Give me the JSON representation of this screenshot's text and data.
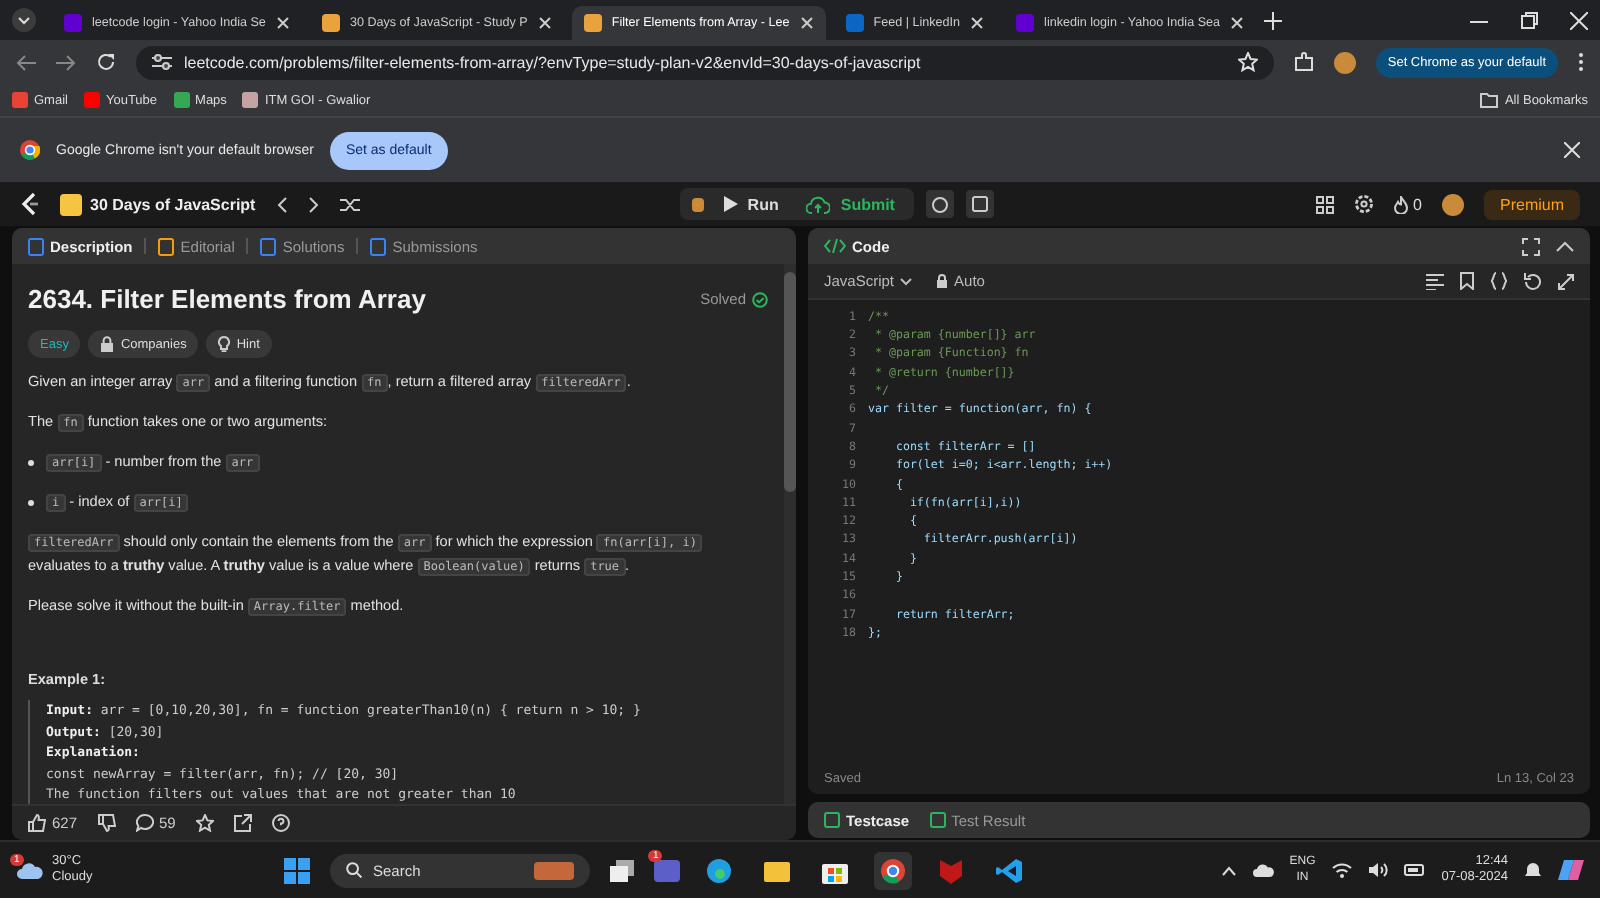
{
  "browser_tabs": [
    {
      "label": "leetcode login - Yahoo India Se",
      "selected": false
    },
    {
      "label": "30 Days of JavaScript - Study P",
      "selected": false
    },
    {
      "label": "Filter Elements from Array - Lee",
      "selected": true
    },
    {
      "label": "Feed | LinkedIn",
      "selected": false
    },
    {
      "label": "linkedin login - Yahoo India Sea",
      "selected": false
    }
  ],
  "address_bar": {
    "url": "leetcode.com/problems/filter-elements-from-array/?envType=study-plan-v2&envId=30-days-of-javascript",
    "default_button": "Set Chrome as your default"
  },
  "bookmarks": {
    "items": [
      "Gmail",
      "YouTube",
      "Maps",
      "ITM GOI - Gwalior"
    ],
    "all": "All Bookmarks"
  },
  "infobar": {
    "message": "Google Chrome isn't your default browser",
    "button": "Set as default"
  },
  "leetcode_nav": {
    "study_plan": "30 Days of JavaScript",
    "run": "Run",
    "submit": "Submit",
    "streak": "0",
    "premium": "Premium"
  },
  "description_panel": {
    "tabs": [
      {
        "label": "Description",
        "selected": true
      },
      {
        "label": "Editorial",
        "selected": false
      },
      {
        "label": "Solutions",
        "selected": false
      },
      {
        "label": "Submissions",
        "selected": false
      }
    ],
    "title": "2634. Filter Elements from Array",
    "status": "Solved",
    "tags": [
      {
        "label": "Easy",
        "kind": "difficulty"
      },
      {
        "label": "Companies",
        "kind": "locked"
      },
      {
        "label": "Hint",
        "kind": "hint"
      }
    ],
    "blocks": [
      {
        "kind": "para",
        "parts": [
          {
            "kind": "text",
            "text": "Given an integer array "
          },
          {
            "kind": "code",
            "text": "arr"
          },
          {
            "kind": "text",
            "text": " and a filtering function "
          },
          {
            "kind": "code",
            "text": "fn"
          },
          {
            "kind": "text",
            "text": ", return a filtered array "
          },
          {
            "kind": "code",
            "text": "filteredArr"
          },
          {
            "kind": "text",
            "text": "."
          }
        ]
      },
      {
        "kind": "para",
        "parts": [
          {
            "kind": "text",
            "text": "The "
          },
          {
            "kind": "code",
            "text": "fn"
          },
          {
            "kind": "text",
            "text": " function takes one or two arguments:"
          }
        ]
      },
      {
        "kind": "bullet",
        "parts": [
          {
            "kind": "code",
            "text": "arr[i]"
          },
          {
            "kind": "text",
            "text": " - number from the "
          },
          {
            "kind": "code",
            "text": "arr"
          }
        ]
      },
      {
        "kind": "bullet",
        "parts": [
          {
            "kind": "code",
            "text": "i"
          },
          {
            "kind": "text",
            "text": " - index of "
          },
          {
            "kind": "code",
            "text": "arr[i]"
          }
        ]
      },
      {
        "kind": "para",
        "parts": [
          {
            "kind": "code",
            "text": "filteredArr"
          },
          {
            "kind": "text",
            "text": " should only contain the elements from the "
          },
          {
            "kind": "code",
            "text": "arr"
          },
          {
            "kind": "text",
            "text": " for which the expression "
          },
          {
            "kind": "code",
            "text": "fn(arr[i], i)"
          },
          {
            "kind": "text",
            "text": " evaluates to a "
          },
          {
            "kind": "bold",
            "text": "truthy"
          },
          {
            "kind": "text",
            "text": " value. A "
          },
          {
            "kind": "bold",
            "text": "truthy"
          },
          {
            "kind": "text",
            "text": " value is a value where "
          },
          {
            "kind": "code",
            "text": "Boolean(value)"
          },
          {
            "kind": "text",
            "text": " returns "
          },
          {
            "kind": "code",
            "text": "true"
          },
          {
            "kind": "text",
            "text": "."
          }
        ]
      },
      {
        "kind": "para",
        "parts": [
          {
            "kind": "text",
            "text": "Please solve it without the built-in "
          },
          {
            "kind": "code",
            "text": "Array.filter"
          },
          {
            "kind": "text",
            "text": " method."
          }
        ]
      },
      {
        "kind": "heading",
        "parts": [
          {
            "kind": "bold",
            "text": "Example 1:"
          }
        ]
      }
    ],
    "example_lines": [
      "**Input:** arr = [0,10,20,30], fn = function greaterThan10(n) { return n > 10; }",
      "**Output:** [20,30]",
      "**Explanation:**",
      "const newArray = filter(arr, fn); // [20, 30]",
      "The function filters out values that are not greater than 10"
    ],
    "likes": "627",
    "comments": "59"
  },
  "code_panel": {
    "title": "Code",
    "language": "JavaScript",
    "mode": "Auto",
    "lines": [
      {
        "number": "1",
        "text": "/**",
        "kind": "comment"
      },
      {
        "number": "2",
        "text": " * @param {number[]} arr",
        "kind": "comment"
      },
      {
        "number": "3",
        "text": " * @param {Function} fn",
        "kind": "comment"
      },
      {
        "number": "4",
        "text": " * @return {number[]}",
        "kind": "comment"
      },
      {
        "number": "5",
        "text": " */",
        "kind": "comment"
      },
      {
        "number": "6",
        "text": "var filter = function(arr, fn) {",
        "kind": "code"
      },
      {
        "number": "7"
      },
      {
        "number": "8",
        "text": "    const filterArr = []",
        "kind": "code"
      },
      {
        "number": "9",
        "text": "    for(let i=0; i<arr.length; i++)",
        "kind": "code"
      },
      {
        "number": "10",
        "text": "    {",
        "kind": "code"
      },
      {
        "number": "11",
        "text": "      if(fn(arr[i],i))",
        "kind": "code"
      },
      {
        "number": "12",
        "text": "      {",
        "kind": "code"
      },
      {
        "number": "13",
        "text": "        filterArr.push(arr[i])",
        "kind": "code"
      },
      {
        "number": "14",
        "text": "      }",
        "kind": "code"
      },
      {
        "number": "15",
        "text": "    }",
        "kind": "code"
      },
      {
        "number": "16"
      },
      {
        "number": "17",
        "text": "    return filterArr;",
        "kind": "code"
      },
      {
        "number": "18",
        "text": "};",
        "kind": "code"
      }
    ],
    "save_status": "Saved",
    "cursor": "Ln 13, Col 23"
  },
  "test_tabs": [
    {
      "label": "Testcase",
      "selected": true
    },
    {
      "label": "Test Result",
      "selected": false
    }
  ],
  "taskbar": {
    "weather_badge": "1",
    "temperature": "30°C",
    "condition": "Cloudy",
    "search": "Search",
    "teams_badge": "1",
    "language": "ENG",
    "region": "IN",
    "time": "12:44",
    "date": "07-08-2024"
  }
}
